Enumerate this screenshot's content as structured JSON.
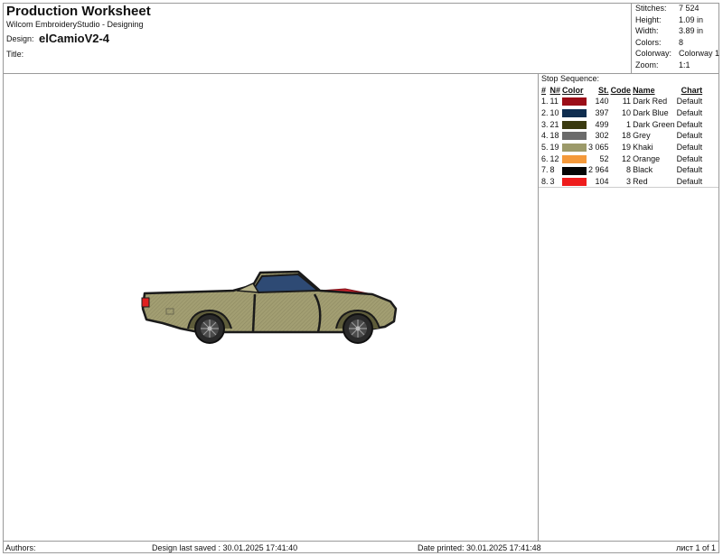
{
  "header": {
    "title": "Production Worksheet",
    "subtitle": "Wilcom EmbroideryStudio - Designing",
    "design_label": "Design:",
    "design_name": "elCamioV2-4",
    "title_label": "Title:"
  },
  "stats": [
    {
      "label": "Stitches:",
      "value": "7 524"
    },
    {
      "label": "Height:",
      "value": "1.09 in"
    },
    {
      "label": "Width:",
      "value": "3.89 in"
    },
    {
      "label": "Colors:",
      "value": "8"
    },
    {
      "label": "Colorway:",
      "value": "Colorway 1"
    },
    {
      "label": "Zoom:",
      "value": "1:1"
    }
  ],
  "stop_sequence": {
    "title": "Stop Sequence:",
    "headers": {
      "num": "#",
      "n": "N#",
      "color": "Color",
      "st": "St.",
      "code": "Code",
      "name": "Name",
      "chart": "Chart"
    },
    "rows": [
      {
        "num": "1.",
        "n": "11",
        "color": "#9b0e18",
        "st": "140",
        "code": "11",
        "name": "Dark Red",
        "chart": "Default"
      },
      {
        "num": "2.",
        "n": "10",
        "color": "#0f2d4f",
        "st": "397",
        "code": "10",
        "name": "Dark Blue",
        "chart": "Default"
      },
      {
        "num": "3.",
        "n": "21",
        "color": "#3a3a10",
        "st": "499",
        "code": "1",
        "name": "Dark Green",
        "chart": "Default"
      },
      {
        "num": "4.",
        "n": "18",
        "color": "#6b6b6b",
        "st": "302",
        "code": "18",
        "name": "Grey",
        "chart": "Default"
      },
      {
        "num": "5.",
        "n": "19",
        "color": "#9c9a6a",
        "st": "3 065",
        "code": "19",
        "name": "Khaki",
        "chart": "Default"
      },
      {
        "num": "6.",
        "n": "12",
        "color": "#f4993a",
        "st": "52",
        "code": "12",
        "name": "Orange",
        "chart": "Default"
      },
      {
        "num": "7.",
        "n": "8",
        "color": "#050505",
        "st": "2 964",
        "code": "8",
        "name": "Black",
        "chart": "Default"
      },
      {
        "num": "8.",
        "n": "3",
        "color": "#ee1c1c",
        "st": "104",
        "code": "3",
        "name": "Red",
        "chart": "Default"
      }
    ]
  },
  "footer": {
    "authors": "Authors:",
    "last_saved": "Design last saved : 30.01.2025 17:41:40",
    "date_printed": "Date printed: 30.01.2025 17:41:48",
    "page": "лист 1 of 1"
  }
}
